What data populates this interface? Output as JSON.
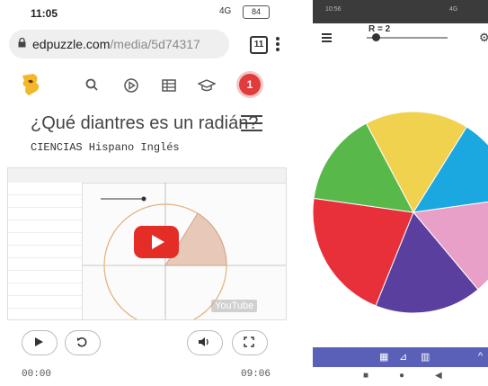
{
  "left_phone": {
    "status": {
      "time": "11:05",
      "network": "4G",
      "battery": "84"
    },
    "browser": {
      "url_main": "edpuzzle.com",
      "url_path": "/media/5d74317",
      "tab_count": "11"
    },
    "page": {
      "notification_count": "1",
      "title": "¿Qué diantres es un radián?",
      "subtitle": "CIENCIAS Hispano Inglés"
    },
    "video": {
      "watermark": "YouTube",
      "play_icon": "play-icon"
    },
    "player": {
      "current_time": "00:00",
      "duration": "09:06"
    }
  },
  "right_phone": {
    "slider_label": "R = 2",
    "status": {
      "time": "10:56",
      "network": "4G"
    },
    "pie_colors": [
      "#f0d24e",
      "#1ba7e0",
      "#e8a0c8",
      "#5b3f9f",
      "#e8303a",
      "#58b84a"
    ],
    "accent": "#5a5fb8"
  }
}
